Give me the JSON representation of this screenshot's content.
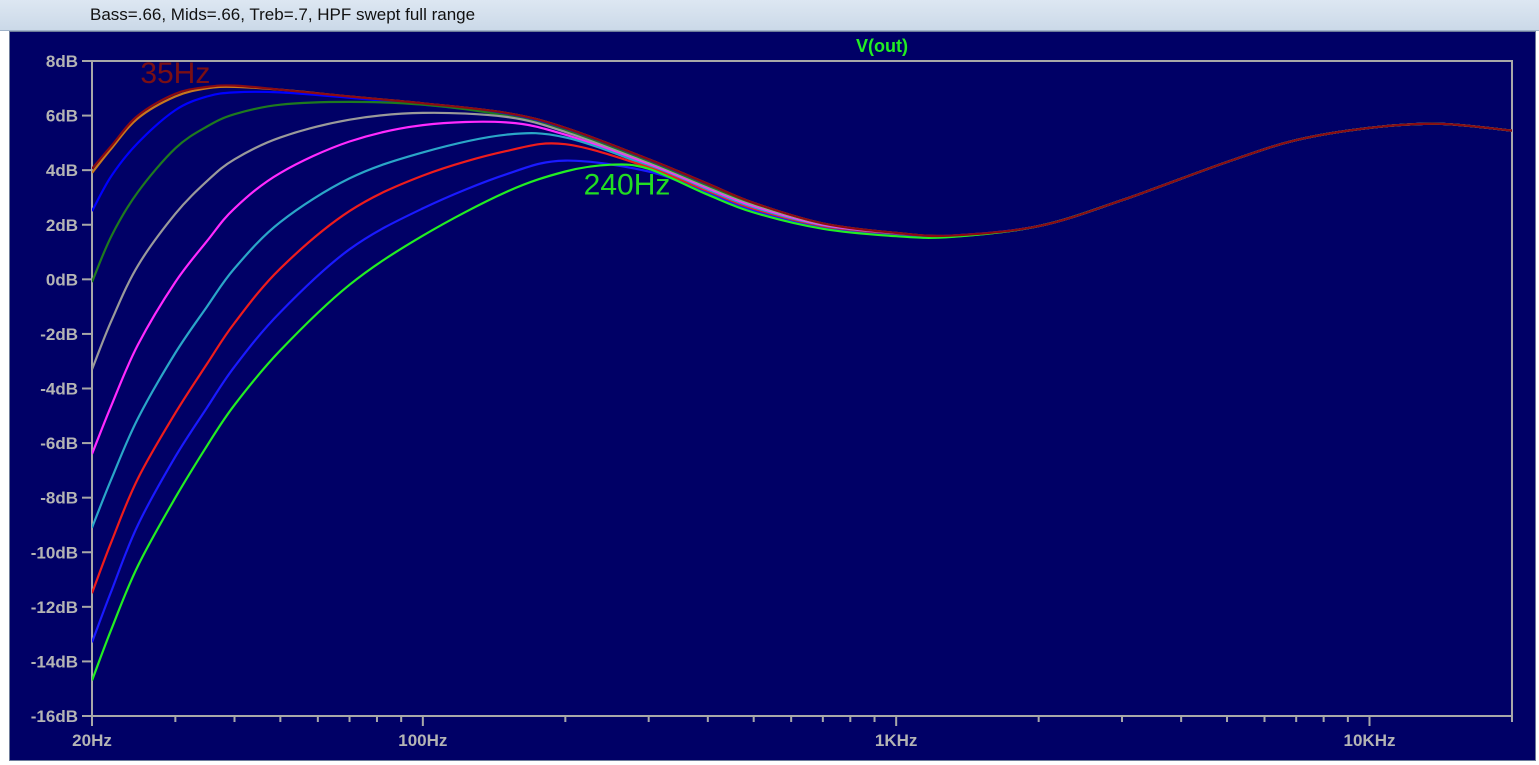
{
  "window": {
    "title": "Bass=.66, Mids=.66, Treb=.7, HPF swept full range"
  },
  "chart_data": {
    "type": "line",
    "title": "V(out)",
    "xscale": "log",
    "xlim": [
      20,
      20000
    ],
    "ylim": [
      -16,
      8
    ],
    "grid": false,
    "yticks": [
      "8dB",
      "6dB",
      "4dB",
      "2dB",
      "0dB",
      "-2dB",
      "-4dB",
      "-6dB",
      "-8dB",
      "-10dB",
      "-12dB",
      "-14dB",
      "-16dB"
    ],
    "ytick_values": [
      8,
      6,
      4,
      2,
      0,
      -2,
      -4,
      -6,
      -8,
      -10,
      -12,
      -14,
      -16
    ],
    "xticks": [
      "20Hz",
      "100Hz",
      "1KHz",
      "10KHz"
    ],
    "xtick_values": [
      20,
      100,
      1000,
      10000
    ],
    "annotations": [
      {
        "text": "35Hz",
        "x": 30,
        "y": 7.2,
        "color": "#7a0f14"
      },
      {
        "text": "240Hz",
        "x": 270,
        "y": 3.1,
        "color": "#22dd22"
      }
    ],
    "series": [
      {
        "color": "#c8781e",
        "points": [
          [
            20,
            3.9
          ],
          [
            22,
            4.8
          ],
          [
            25,
            5.9
          ],
          [
            30,
            6.7
          ],
          [
            35,
            7.0
          ],
          [
            40,
            7.05
          ],
          [
            50,
            6.95
          ],
          [
            70,
            6.7
          ],
          [
            100,
            6.45
          ],
          [
            150,
            6.1
          ],
          [
            200,
            5.55
          ],
          [
            300,
            4.4
          ],
          [
            400,
            3.5
          ],
          [
            500,
            2.8
          ],
          [
            700,
            2.05
          ],
          [
            1000,
            1.7
          ],
          [
            1300,
            1.6
          ],
          [
            2000,
            1.95
          ],
          [
            3000,
            2.9
          ],
          [
            5000,
            4.3
          ],
          [
            7000,
            5.1
          ],
          [
            10000,
            5.55
          ],
          [
            14000,
            5.7
          ],
          [
            20000,
            5.45
          ]
        ]
      },
      {
        "color": "#0000ff",
        "points": [
          [
            20,
            2.5
          ],
          [
            22,
            3.8
          ],
          [
            25,
            5.0
          ],
          [
            30,
            6.2
          ],
          [
            35,
            6.7
          ],
          [
            40,
            6.85
          ],
          [
            50,
            6.85
          ],
          [
            70,
            6.65
          ],
          [
            100,
            6.4
          ],
          [
            150,
            6.05
          ],
          [
            200,
            5.5
          ],
          [
            300,
            4.35
          ],
          [
            400,
            3.45
          ],
          [
            500,
            2.78
          ],
          [
            700,
            2.02
          ],
          [
            1000,
            1.68
          ],
          [
            1300,
            1.6
          ],
          [
            2000,
            1.95
          ],
          [
            3000,
            2.9
          ],
          [
            5000,
            4.3
          ],
          [
            7000,
            5.1
          ],
          [
            10000,
            5.55
          ],
          [
            14000,
            5.7
          ],
          [
            20000,
            5.45
          ]
        ]
      },
      {
        "color": "#1e7a1e",
        "points": [
          [
            20,
            -0.1
          ],
          [
            22,
            1.6
          ],
          [
            25,
            3.2
          ],
          [
            30,
            4.8
          ],
          [
            35,
            5.6
          ],
          [
            40,
            6.05
          ],
          [
            50,
            6.4
          ],
          [
            70,
            6.5
          ],
          [
            100,
            6.4
          ],
          [
            150,
            6.0
          ],
          [
            200,
            5.45
          ],
          [
            300,
            4.3
          ],
          [
            400,
            3.4
          ],
          [
            500,
            2.75
          ],
          [
            700,
            2.0
          ],
          [
            1000,
            1.66
          ],
          [
            1300,
            1.58
          ],
          [
            2000,
            1.95
          ],
          [
            3000,
            2.9
          ],
          [
            5000,
            4.3
          ],
          [
            7000,
            5.1
          ],
          [
            10000,
            5.55
          ],
          [
            14000,
            5.7
          ],
          [
            20000,
            5.45
          ]
        ]
      },
      {
        "color": "#9a9a9a",
        "points": [
          [
            20,
            -3.3
          ],
          [
            22,
            -1.5
          ],
          [
            25,
            0.5
          ],
          [
            30,
            2.4
          ],
          [
            35,
            3.6
          ],
          [
            40,
            4.4
          ],
          [
            50,
            5.2
          ],
          [
            70,
            5.85
          ],
          [
            100,
            6.1
          ],
          [
            150,
            5.95
          ],
          [
            200,
            5.4
          ],
          [
            300,
            4.25
          ],
          [
            400,
            3.35
          ],
          [
            500,
            2.7
          ],
          [
            700,
            1.98
          ],
          [
            1000,
            1.65
          ],
          [
            1300,
            1.58
          ],
          [
            2000,
            1.95
          ],
          [
            3000,
            2.9
          ],
          [
            5000,
            4.3
          ],
          [
            7000,
            5.1
          ],
          [
            10000,
            5.55
          ],
          [
            14000,
            5.7
          ],
          [
            20000,
            5.45
          ]
        ]
      },
      {
        "color": "#ff2aff",
        "points": [
          [
            20,
            -6.4
          ],
          [
            22,
            -4.6
          ],
          [
            25,
            -2.4
          ],
          [
            30,
            -0.1
          ],
          [
            35,
            1.4
          ],
          [
            40,
            2.6
          ],
          [
            50,
            3.9
          ],
          [
            70,
            5.05
          ],
          [
            100,
            5.65
          ],
          [
            150,
            5.75
          ],
          [
            200,
            5.3
          ],
          [
            300,
            4.2
          ],
          [
            400,
            3.3
          ],
          [
            500,
            2.65
          ],
          [
            700,
            1.95
          ],
          [
            1000,
            1.63
          ],
          [
            1300,
            1.57
          ],
          [
            2000,
            1.95
          ],
          [
            3000,
            2.9
          ],
          [
            5000,
            4.3
          ],
          [
            7000,
            5.1
          ],
          [
            10000,
            5.55
          ],
          [
            14000,
            5.7
          ],
          [
            20000,
            5.45
          ]
        ]
      },
      {
        "color": "#2aa6c8",
        "points": [
          [
            20,
            -9.1
          ],
          [
            22,
            -7.3
          ],
          [
            25,
            -5.1
          ],
          [
            30,
            -2.7
          ],
          [
            35,
            -1.0
          ],
          [
            40,
            0.4
          ],
          [
            50,
            2.1
          ],
          [
            70,
            3.7
          ],
          [
            100,
            4.65
          ],
          [
            150,
            5.3
          ],
          [
            200,
            5.2
          ],
          [
            300,
            4.15
          ],
          [
            400,
            3.25
          ],
          [
            500,
            2.6
          ],
          [
            700,
            1.92
          ],
          [
            1000,
            1.62
          ],
          [
            1300,
            1.57
          ],
          [
            2000,
            1.95
          ],
          [
            3000,
            2.9
          ],
          [
            5000,
            4.3
          ],
          [
            7000,
            5.1
          ],
          [
            10000,
            5.55
          ],
          [
            14000,
            5.7
          ],
          [
            20000,
            5.45
          ]
        ]
      },
      {
        "color": "#ee1c1c",
        "points": [
          [
            20,
            -11.5
          ],
          [
            22,
            -9.6
          ],
          [
            25,
            -7.3
          ],
          [
            30,
            -4.9
          ],
          [
            35,
            -3.1
          ],
          [
            40,
            -1.6
          ],
          [
            50,
            0.4
          ],
          [
            70,
            2.5
          ],
          [
            100,
            3.8
          ],
          [
            150,
            4.7
          ],
          [
            200,
            4.95
          ],
          [
            300,
            4.1
          ],
          [
            400,
            3.2
          ],
          [
            500,
            2.55
          ],
          [
            700,
            1.9
          ],
          [
            1000,
            1.61
          ],
          [
            1300,
            1.56
          ],
          [
            2000,
            1.95
          ],
          [
            3000,
            2.9
          ],
          [
            5000,
            4.3
          ],
          [
            7000,
            5.1
          ],
          [
            10000,
            5.55
          ],
          [
            14000,
            5.7
          ],
          [
            20000,
            5.45
          ]
        ]
      },
      {
        "color": "#1a1aff",
        "points": [
          [
            20,
            -13.3
          ],
          [
            22,
            -11.4
          ],
          [
            25,
            -9.0
          ],
          [
            30,
            -6.5
          ],
          [
            35,
            -4.7
          ],
          [
            40,
            -3.2
          ],
          [
            50,
            -1.2
          ],
          [
            70,
            1.1
          ],
          [
            100,
            2.6
          ],
          [
            150,
            3.85
          ],
          [
            200,
            4.35
          ],
          [
            300,
            3.95
          ],
          [
            400,
            3.15
          ],
          [
            500,
            2.5
          ],
          [
            700,
            1.87
          ],
          [
            1000,
            1.6
          ],
          [
            1300,
            1.56
          ],
          [
            2000,
            1.95
          ],
          [
            3000,
            2.9
          ],
          [
            5000,
            4.3
          ],
          [
            7000,
            5.1
          ],
          [
            10000,
            5.55
          ],
          [
            14000,
            5.7
          ],
          [
            20000,
            5.45
          ]
        ]
      },
      {
        "color": "#22ee22",
        "points": [
          [
            20,
            -14.7
          ],
          [
            22,
            -12.8
          ],
          [
            25,
            -10.5
          ],
          [
            30,
            -8.0
          ],
          [
            35,
            -6.1
          ],
          [
            40,
            -4.6
          ],
          [
            50,
            -2.6
          ],
          [
            70,
            -0.2
          ],
          [
            100,
            1.6
          ],
          [
            150,
            3.2
          ],
          [
            200,
            3.95
          ],
          [
            250,
            4.2
          ],
          [
            300,
            4.05
          ],
          [
            400,
            3.1
          ],
          [
            500,
            2.45
          ],
          [
            700,
            1.85
          ],
          [
            1000,
            1.58
          ],
          [
            1300,
            1.55
          ],
          [
            2000,
            1.95
          ],
          [
            3000,
            2.9
          ],
          [
            5000,
            4.3
          ],
          [
            7000,
            5.1
          ],
          [
            10000,
            5.55
          ],
          [
            14000,
            5.7
          ],
          [
            20000,
            5.45
          ]
        ]
      },
      {
        "color": "#8b0a12",
        "points": [
          [
            20,
            4.05
          ],
          [
            22,
            4.9
          ],
          [
            25,
            6.0
          ],
          [
            30,
            6.8
          ],
          [
            35,
            7.05
          ],
          [
            40,
            7.1
          ],
          [
            50,
            6.95
          ],
          [
            70,
            6.7
          ],
          [
            100,
            6.45
          ],
          [
            150,
            6.1
          ],
          [
            200,
            5.55
          ],
          [
            300,
            4.4
          ],
          [
            400,
            3.5
          ],
          [
            500,
            2.8
          ],
          [
            700,
            2.05
          ],
          [
            1000,
            1.7
          ],
          [
            1300,
            1.6
          ],
          [
            2000,
            1.95
          ],
          [
            3000,
            2.9
          ],
          [
            5000,
            4.3
          ],
          [
            7000,
            5.1
          ],
          [
            10000,
            5.55
          ],
          [
            14000,
            5.7
          ],
          [
            20000,
            5.45
          ]
        ]
      }
    ]
  }
}
